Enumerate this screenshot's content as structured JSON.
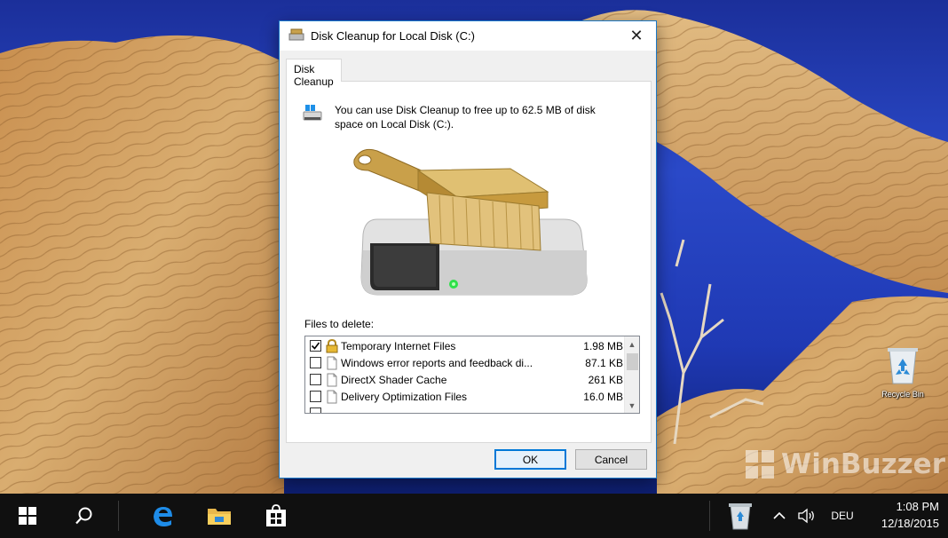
{
  "dialog": {
    "title": "Disk Cleanup for Local Disk (C:)",
    "tab_label": "Disk Cleanup",
    "info_text": "You can use Disk Cleanup to free up to 62.5 MB of disk space on Local Disk (C:).",
    "files_label": "Files to delete:",
    "files": [
      {
        "name": "Temporary Internet Files",
        "size": "1.98 MB",
        "checked": true,
        "icon": "lock-icon"
      },
      {
        "name": "Windows error reports and feedback di...",
        "size": "87.1 KB",
        "checked": false,
        "icon": "file-icon"
      },
      {
        "name": "DirectX Shader Cache",
        "size": "261 KB",
        "checked": false,
        "icon": "file-icon"
      },
      {
        "name": "Delivery Optimization Files",
        "size": "16.0 MB",
        "checked": false,
        "icon": "file-icon"
      }
    ],
    "ok_label": "OK",
    "cancel_label": "Cancel"
  },
  "desktop": {
    "recycle_bin_label": "Recycle Bin",
    "watermark": "WinBuzzer"
  },
  "taskbar": {
    "pinned": [
      "windows-start-icon",
      "search-icon",
      "edge-browser-icon",
      "file-explorer-icon",
      "store-icon"
    ],
    "language": "DEU",
    "time": "1:08 PM",
    "date": "12/18/2015"
  },
  "colors": {
    "accent": "#0078d7",
    "dialog_border": "#1979ca",
    "taskbar_bg": "#101010",
    "sky": "#2a49c8",
    "sandstone": "#d8a968"
  }
}
